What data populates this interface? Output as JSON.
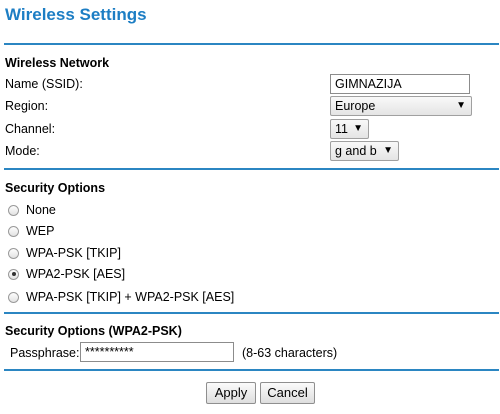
{
  "page": {
    "title": "Wireless Settings"
  },
  "wireless_network": {
    "heading": "Wireless Network",
    "ssid_label": "Name (SSID):",
    "ssid_value": "GIMNAZIJA",
    "region_label": "Region:",
    "region_value": "Europe",
    "channel_label": "Channel:",
    "channel_value": "11",
    "mode_label": "Mode:",
    "mode_value": "g and b"
  },
  "security_options": {
    "heading": "Security Options",
    "selected": "WPA2-PSK [AES]",
    "options": [
      {
        "label": "None"
      },
      {
        "label": "WEP"
      },
      {
        "label": "WPA-PSK [TKIP]"
      },
      {
        "label": "WPA2-PSK [AES]"
      },
      {
        "label": "WPA-PSK [TKIP] + WPA2-PSK [AES]"
      }
    ]
  },
  "wpa2": {
    "heading": "Security Options (WPA2-PSK)",
    "passphrase_label": "Passphrase:",
    "passphrase_value": "**********",
    "hint": "(8-63 characters)"
  },
  "buttons": {
    "apply": "Apply",
    "cancel": "Cancel"
  },
  "colors": {
    "accent": "#1d7ec4",
    "rule": "#2b86c2"
  },
  "icons": {
    "dropdown": "triangle-down"
  }
}
